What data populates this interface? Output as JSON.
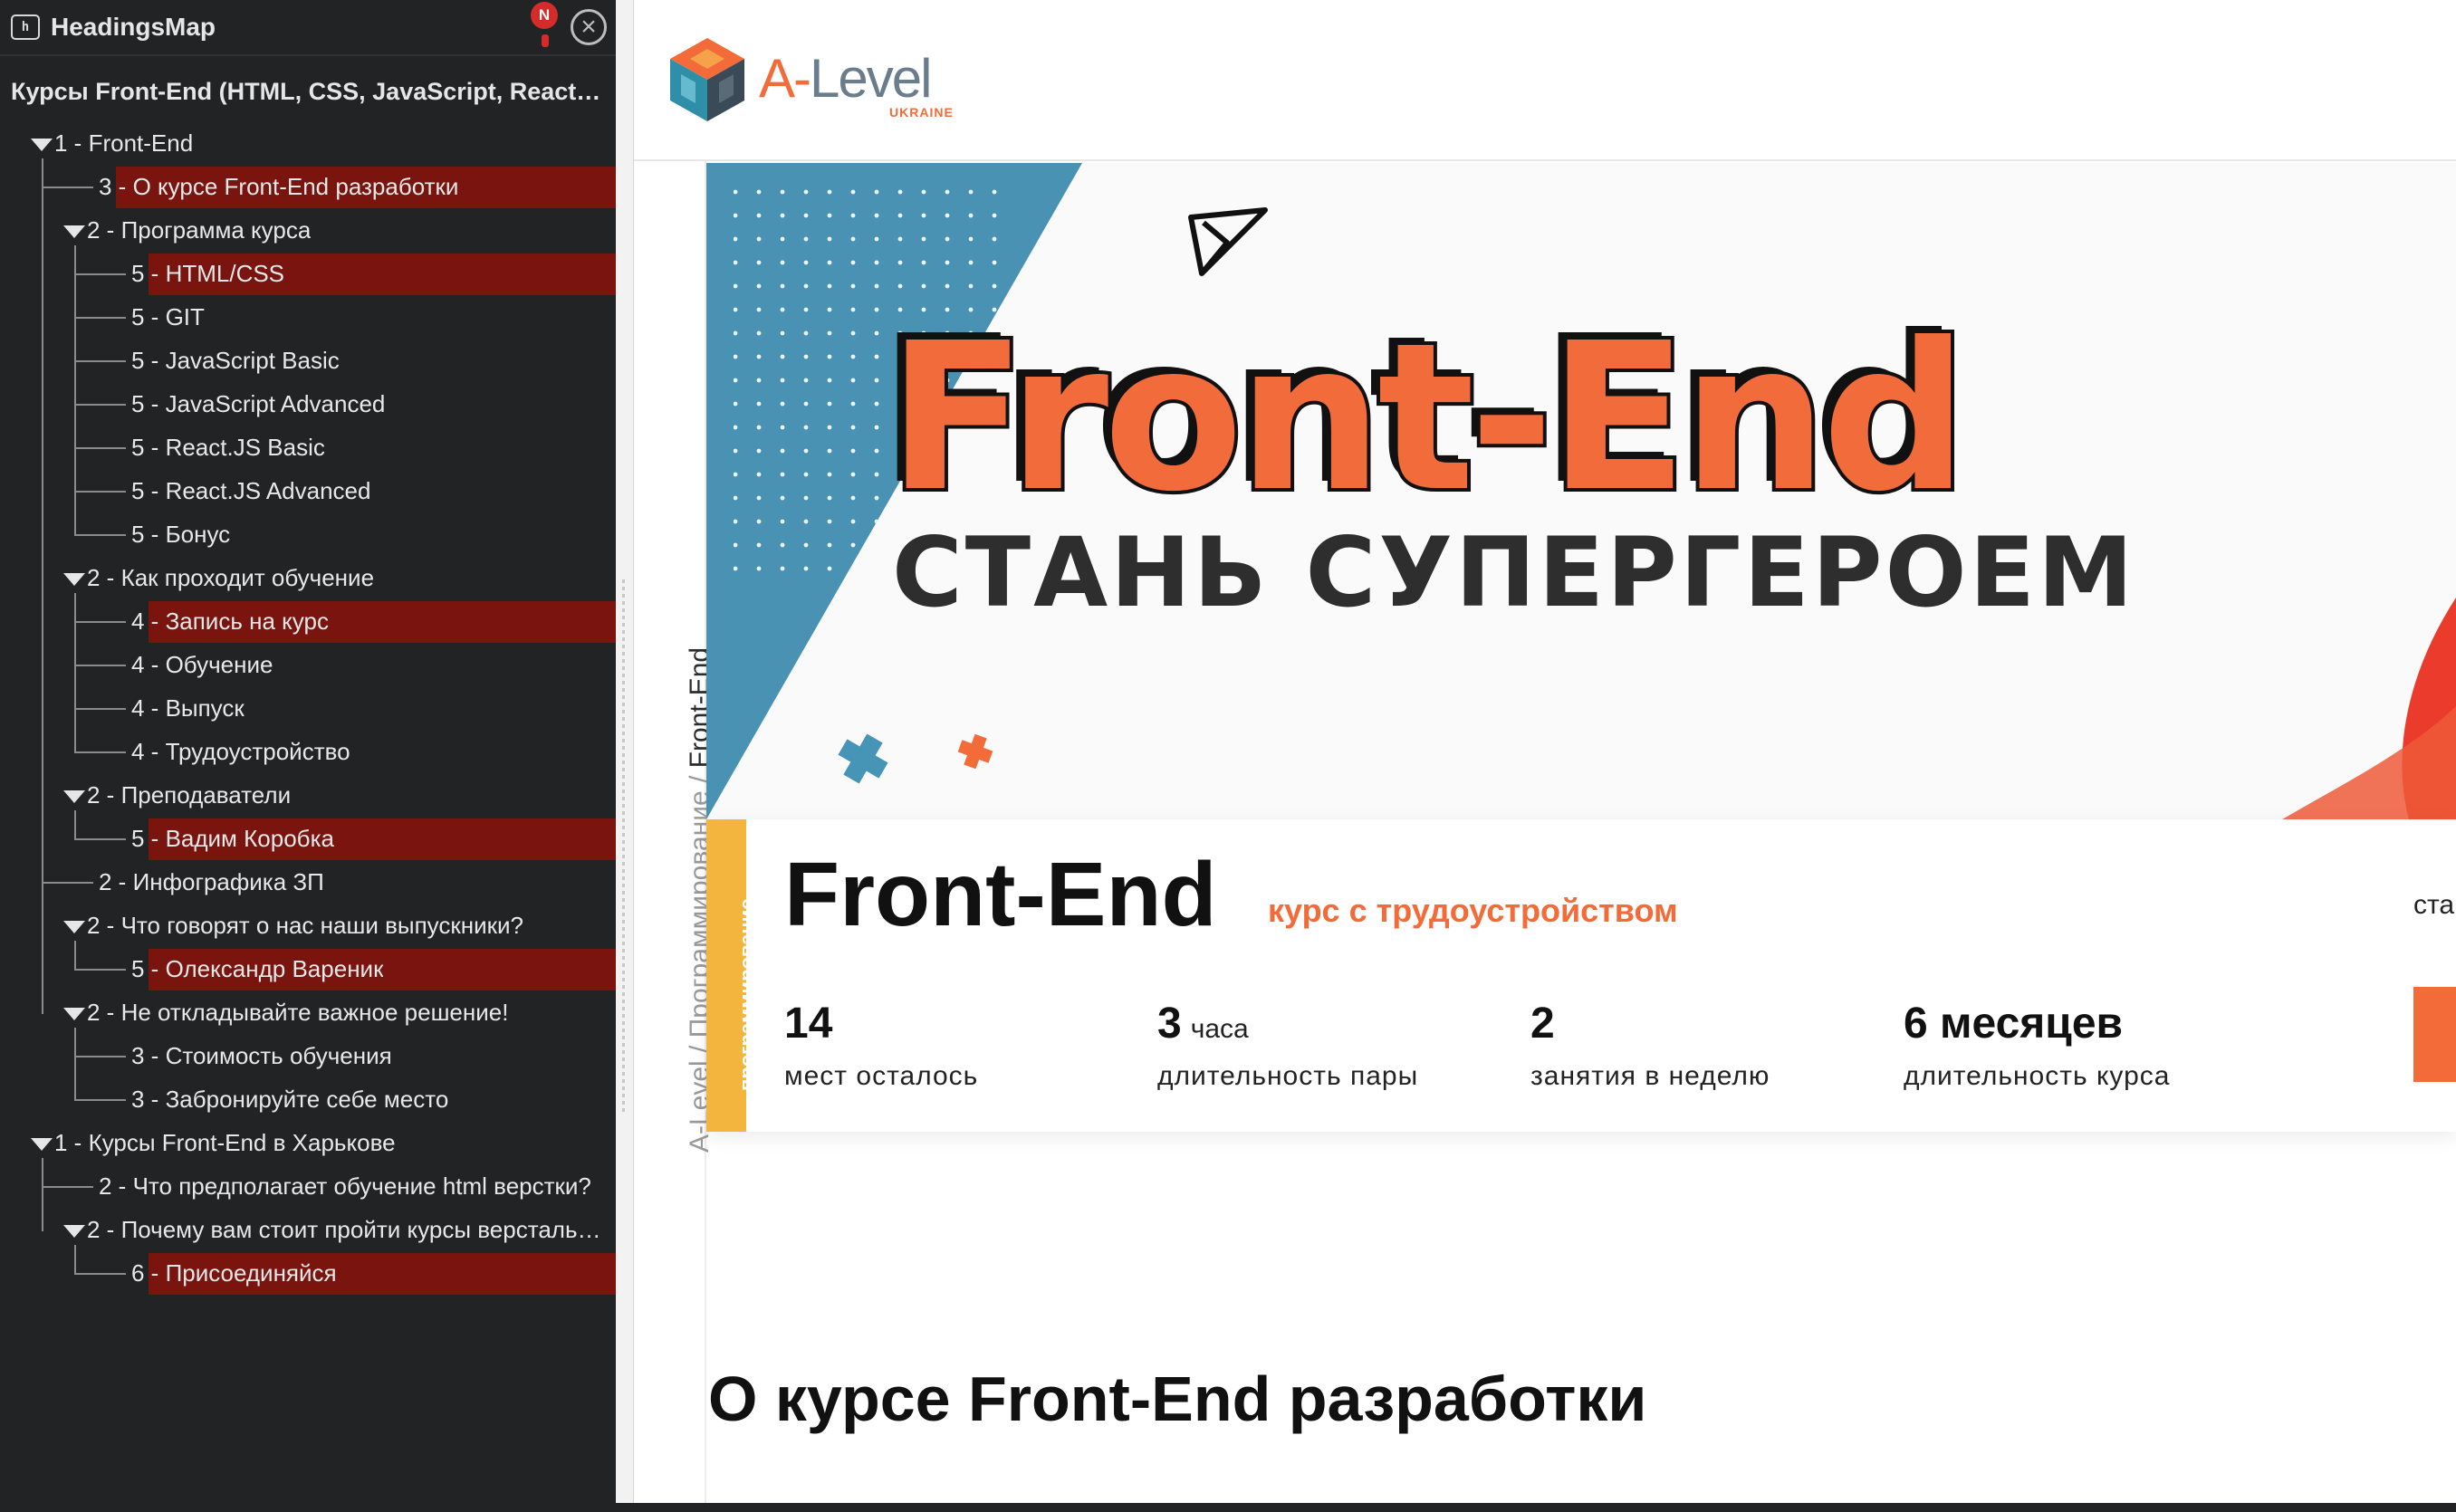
{
  "headingsmap": {
    "title": "HeadingsMap",
    "notification_badge": "N",
    "page_title": "Курсы Front-End (HTML, CSS, JavaScript, ReactJS) в Харькове",
    "items": [
      {
        "level": "1",
        "label": "Front-End",
        "highlighted": false
      },
      {
        "level": "3",
        "label": "О курсе Front-End разработки",
        "highlighted": true
      },
      {
        "level": "2",
        "label": "Программа курса",
        "highlighted": false
      },
      {
        "level": "5",
        "label": "HTML/CSS",
        "highlighted": true
      },
      {
        "level": "5",
        "label": "GIT",
        "highlighted": false
      },
      {
        "level": "5",
        "label": "JavaScript Basic",
        "highlighted": false
      },
      {
        "level": "5",
        "label": "JavaScript Advanced",
        "highlighted": false
      },
      {
        "level": "5",
        "label": "React.JS Basic",
        "highlighted": false
      },
      {
        "level": "5",
        "label": "React.JS Advanced",
        "highlighted": false
      },
      {
        "level": "5",
        "label": "Бонус",
        "highlighted": false
      },
      {
        "level": "2",
        "label": "Как проходит обучение",
        "highlighted": false
      },
      {
        "level": "4",
        "label": "Запись на курс",
        "highlighted": true
      },
      {
        "level": "4",
        "label": "Обучение",
        "highlighted": false
      },
      {
        "level": "4",
        "label": "Выпуск",
        "highlighted": false
      },
      {
        "level": "4",
        "label": "Трудоустройство",
        "highlighted": false
      },
      {
        "level": "2",
        "label": "Преподаватели",
        "highlighted": false
      },
      {
        "level": "5",
        "label": "Вадим Коробка",
        "highlighted": true
      },
      {
        "level": "2",
        "label": "Инфографика ЗП",
        "highlighted": false
      },
      {
        "level": "2",
        "label": "Что говорят о нас наши выпускники?",
        "highlighted": false
      },
      {
        "level": "5",
        "label": "Олександр Вареник",
        "highlighted": true
      },
      {
        "level": "2",
        "label": "Не откладывайте важное решение!",
        "highlighted": false
      },
      {
        "level": "3",
        "label": "Стоимость обучения",
        "highlighted": false
      },
      {
        "level": "3",
        "label": "Забронируйте себе место",
        "highlighted": false
      },
      {
        "level": "1",
        "label": "Курсы Front-End в Харькове",
        "highlighted": false
      },
      {
        "level": "2",
        "label": "Что предполагает обучение html верстки?",
        "highlighted": false
      },
      {
        "level": "2",
        "label": "Почему вам стоит пройти курсы верстальщика сайтов",
        "highlighted": false
      },
      {
        "level": "6",
        "label": "Присоединяйся",
        "highlighted": true
      }
    ]
  },
  "site": {
    "brand": {
      "name_a": "A-",
      "name_level": "Level",
      "sub": "UKRAINE"
    },
    "breadcrumb": {
      "root": "A-Level",
      "sep": " / ",
      "section": "Программирование",
      "current": "Front-End"
    },
    "hero": {
      "big_text": "Front-End",
      "slogan": "СТАНЬ СУПЕРГЕРОЕМ"
    },
    "course": {
      "tag": "программирование",
      "name": "Front-End",
      "subtitle": "курс с трудоустройством",
      "right_text": "ста",
      "stats": [
        {
          "value": "14",
          "unit": "",
          "caption": "мест осталось"
        },
        {
          "value": "3",
          "unit": "часа",
          "caption": "длительность пары"
        },
        {
          "value": "2",
          "unit": "",
          "caption": "занятия в неделю"
        },
        {
          "value": "6 месяцев",
          "unit": "",
          "caption": "длительность курса"
        }
      ]
    },
    "section_title": "О курсе Front-End разработки"
  },
  "colors": {
    "panel_bg": "#222325",
    "highlight": "#7a140f",
    "accent_orange": "#f26b38",
    "accent_blue": "#4795b6",
    "tag_yellow": "#f4b53f"
  }
}
